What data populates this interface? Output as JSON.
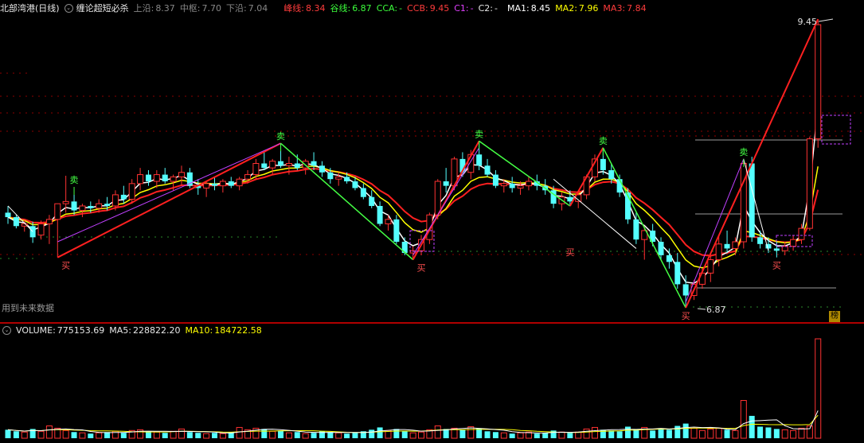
{
  "header": {
    "title": "北部湾港(日线)",
    "indicator": "缠论超短必杀",
    "upper_label": "上沿:",
    "upper": "8.37",
    "mid_label": "中枢:",
    "mid": "7.70",
    "lower_label": "下沿:",
    "lower": "7.04",
    "peak_label": "峰线:",
    "peak": "8.34",
    "valley_label": "谷线:",
    "valley": "6.87",
    "cca_label": "CCA:",
    "cca": "-",
    "ccb_label": "CCB:",
    "ccb": "9.45",
    "c1_label": "C1:",
    "c1": "-",
    "c2_label": "C2:",
    "c2": "-",
    "ma1_label": "MA1:",
    "ma1": "8.45",
    "ma2_label": "MA2:",
    "ma2": "7.96",
    "ma3_label": "MA3:",
    "ma3": "7.84"
  },
  "labels": {
    "high_price": "9.45",
    "low_price": "6.87",
    "future_data_note": "用到未来数据",
    "sell": "卖",
    "buy": "买",
    "rank_button": "榜"
  },
  "volume_header": {
    "volume_label": "VOLUME:",
    "volume": "775153.69",
    "ma5_label": "MA5:",
    "ma5": "228822.20",
    "ma10_label": "MA10:",
    "ma10": "184722.58"
  },
  "colors": {
    "up": "#ff3232",
    "down": "#54ffff",
    "ma1": "#ffffff",
    "ma2": "#ffff00",
    "ma3": "#ff2020",
    "zigzag_up": "#ff2020",
    "zigzag_down": "#44ff44",
    "purple": "#c040ff",
    "grid": "#8b0000"
  },
  "chart_data": {
    "type": "candlestick",
    "price_range": [
      6.87,
      9.45
    ],
    "candles": [
      [
        7.72,
        7.78,
        7.62,
        7.68
      ],
      [
        7.68,
        7.7,
        7.58,
        7.6
      ],
      [
        7.6,
        7.66,
        7.55,
        7.62
      ],
      [
        7.6,
        7.64,
        7.45,
        7.5
      ],
      [
        7.52,
        7.65,
        7.48,
        7.62
      ],
      [
        7.62,
        7.7,
        7.44,
        7.66
      ],
      [
        7.66,
        7.8,
        7.32,
        7.8
      ],
      [
        7.8,
        8.05,
        7.72,
        7.82
      ],
      [
        7.82,
        7.88,
        7.7,
        7.74
      ],
      [
        7.74,
        7.8,
        7.68,
        7.78
      ],
      [
        7.78,
        7.82,
        7.72,
        7.76
      ],
      [
        7.76,
        7.84,
        7.72,
        7.8
      ],
      [
        7.8,
        7.86,
        7.74,
        7.78
      ],
      [
        7.78,
        7.92,
        7.74,
        7.88
      ],
      [
        7.88,
        7.96,
        7.8,
        7.84
      ],
      [
        7.84,
        8.02,
        7.8,
        7.98
      ],
      [
        7.98,
        8.12,
        7.92,
        8.06
      ],
      [
        8.06,
        8.1,
        7.96,
        8.0
      ],
      [
        8.0,
        8.1,
        7.94,
        8.06
      ],
      [
        8.06,
        8.12,
        7.98,
        8.0
      ],
      [
        8.0,
        8.06,
        7.92,
        8.04
      ],
      [
        8.04,
        8.14,
        7.96,
        8.08
      ],
      [
        8.08,
        8.12,
        7.94,
        7.96
      ],
      [
        7.96,
        8.02,
        7.88,
        7.94
      ],
      [
        7.94,
        8.0,
        7.86,
        7.98
      ],
      [
        7.98,
        8.04,
        7.92,
        7.96
      ],
      [
        7.96,
        8.02,
        7.9,
        8.0
      ],
      [
        8.0,
        8.04,
        7.94,
        7.96
      ],
      [
        7.96,
        8.04,
        7.92,
        8.02
      ],
      [
        8.02,
        8.1,
        7.98,
        8.06
      ],
      [
        8.06,
        8.2,
        8.02,
        8.16
      ],
      [
        8.16,
        8.26,
        8.1,
        8.12
      ],
      [
        8.12,
        8.2,
        8.06,
        8.18
      ],
      [
        8.18,
        8.34,
        8.12,
        8.14
      ],
      [
        8.14,
        8.22,
        8.06,
        8.16
      ],
      [
        8.16,
        8.24,
        8.1,
        8.12
      ],
      [
        8.12,
        8.2,
        8.06,
        8.18
      ],
      [
        8.18,
        8.26,
        8.1,
        8.14
      ],
      [
        8.14,
        8.18,
        8.04,
        8.08
      ],
      [
        8.08,
        8.12,
        7.98,
        8.02
      ],
      [
        8.02,
        8.08,
        7.96,
        8.04
      ],
      [
        8.04,
        8.08,
        7.98,
        8.0
      ],
      [
        8.0,
        8.04,
        7.92,
        7.94
      ],
      [
        7.94,
        7.98,
        7.84,
        7.86
      ],
      [
        7.86,
        7.92,
        7.76,
        7.78
      ],
      [
        7.78,
        7.82,
        7.6,
        7.62
      ],
      [
        7.62,
        7.7,
        7.56,
        7.66
      ],
      [
        7.66,
        7.7,
        7.44,
        7.46
      ],
      [
        7.46,
        7.5,
        7.34,
        7.36
      ],
      [
        7.36,
        7.42,
        7.3,
        7.38
      ],
      [
        7.38,
        7.52,
        7.34,
        7.48
      ],
      [
        7.48,
        7.72,
        7.44,
        7.7
      ],
      [
        7.7,
        8.02,
        7.66,
        8.0
      ],
      [
        8.0,
        8.12,
        7.9,
        7.96
      ],
      [
        7.96,
        8.22,
        7.92,
        8.2
      ],
      [
        8.2,
        8.26,
        8.04,
        8.08
      ],
      [
        8.08,
        8.28,
        8.02,
        8.24
      ],
      [
        8.24,
        8.36,
        8.1,
        8.14
      ],
      [
        8.14,
        8.2,
        8.04,
        8.06
      ],
      [
        8.06,
        8.1,
        7.94,
        7.96
      ],
      [
        7.96,
        8.02,
        7.9,
        7.98
      ],
      [
        7.98,
        8.04,
        7.9,
        7.94
      ],
      [
        7.94,
        8.0,
        7.88,
        7.96
      ],
      [
        7.96,
        8.04,
        7.92,
        8.0
      ],
      [
        8.0,
        8.06,
        7.92,
        7.96
      ],
      [
        7.96,
        8.02,
        7.88,
        7.92
      ],
      [
        7.92,
        7.96,
        7.76,
        7.8
      ],
      [
        7.8,
        7.9,
        7.74,
        7.86
      ],
      [
        7.86,
        7.92,
        7.78,
        7.82
      ],
      [
        7.82,
        7.9,
        7.76,
        7.88
      ],
      [
        7.88,
        8.06,
        7.84,
        8.04
      ],
      [
        8.04,
        8.24,
        8.0,
        8.2
      ],
      [
        8.2,
        8.3,
        8.06,
        8.1
      ],
      [
        8.1,
        8.16,
        7.98,
        8.02
      ],
      [
        8.02,
        8.06,
        7.86,
        7.9
      ],
      [
        7.9,
        7.94,
        7.62,
        7.66
      ],
      [
        7.66,
        7.72,
        7.44,
        7.48
      ],
      [
        7.48,
        7.6,
        7.3,
        7.56
      ],
      [
        7.56,
        7.62,
        7.42,
        7.46
      ],
      [
        7.46,
        7.5,
        7.3,
        7.34
      ],
      [
        7.34,
        7.4,
        7.22,
        7.28
      ],
      [
        7.28,
        7.36,
        7.04,
        7.08
      ],
      [
        7.08,
        7.16,
        6.87,
        6.98
      ],
      [
        6.98,
        7.12,
        6.94,
        7.08
      ],
      [
        7.08,
        7.22,
        7.04,
        7.18
      ],
      [
        7.18,
        7.34,
        7.1,
        7.3
      ],
      [
        7.3,
        7.52,
        7.24,
        7.44
      ],
      [
        7.44,
        7.56,
        7.36,
        7.4
      ],
      [
        7.4,
        7.5,
        7.34,
        7.46
      ],
      [
        7.46,
        8.2,
        7.4,
        8.16
      ],
      [
        8.16,
        8.22,
        7.46,
        7.5
      ],
      [
        7.5,
        7.56,
        7.4,
        7.44
      ],
      [
        7.44,
        7.5,
        7.36,
        7.4
      ],
      [
        7.4,
        7.46,
        7.32,
        7.38
      ],
      [
        7.38,
        7.46,
        7.34,
        7.42
      ],
      [
        7.42,
        7.52,
        7.38,
        7.48
      ],
      [
        7.48,
        7.62,
        7.44,
        7.58
      ],
      [
        7.58,
        8.4,
        7.56,
        8.38
      ],
      [
        8.38,
        9.45,
        8.3,
        9.4
      ]
    ],
    "volume_range": [
      0,
      775153.69
    ],
    "volumes": [
      1.1,
      0.9,
      0.8,
      1.2,
      0.9,
      1.6,
      1.3,
      1.0,
      0.8,
      0.7,
      0.6,
      0.7,
      0.8,
      0.9,
      0.7,
      1.0,
      1.1,
      0.9,
      0.8,
      0.7,
      0.9,
      1.2,
      0.8,
      0.7,
      0.6,
      0.7,
      0.6,
      0.8,
      1.4,
      1.1,
      1.3,
      1.2,
      0.9,
      1.0,
      0.7,
      0.8,
      0.6,
      0.7,
      0.9,
      0.8,
      0.7,
      0.6,
      0.7,
      0.9,
      1.1,
      1.4,
      1.0,
      1.2,
      0.9,
      0.7,
      0.8,
      1.1,
      1.6,
      1.2,
      1.3,
      1.1,
      1.5,
      1.3,
      0.9,
      0.8,
      0.7,
      0.6,
      0.7,
      0.8,
      0.6,
      0.7,
      1.0,
      0.8,
      0.7,
      0.8,
      1.2,
      1.4,
      1.1,
      1.0,
      0.9,
      1.5,
      1.2,
      1.4,
      1.0,
      1.3,
      1.1,
      1.6,
      1.9,
      1.3,
      1.0,
      1.2,
      1.3,
      1.1,
      1.0,
      4.9,
      2.9,
      1.5,
      1.4,
      1.2,
      1.1,
      1.0,
      1.3,
      1.6,
      12.9
    ],
    "volume_unit": "x60000"
  }
}
